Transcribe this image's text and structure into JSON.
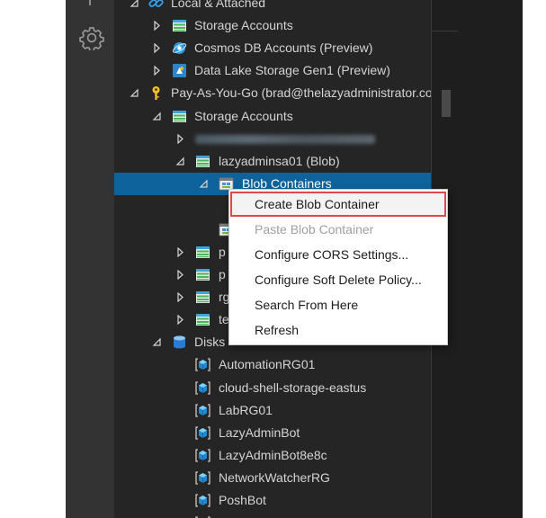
{
  "activity_bar": {
    "settings_icon": "gear-icon"
  },
  "tree": {
    "local_attached": "Local & Attached",
    "local_storage_accounts": "Storage Accounts",
    "cosmos_db": "Cosmos DB Accounts (Preview)",
    "data_lake": "Data Lake Storage Gen1 (Preview)",
    "subscription": "Pay-As-You-Go (brad@thelazyadministrator.com)",
    "storage_accounts": "Storage Accounts",
    "account_lazyadminsa01": "lazyadminsa01 (Blob)",
    "blob_containers": "Blob Containers",
    "partial_p1": "p",
    "partial_p2": "p",
    "partial_rg": "rg",
    "partial_te": "te",
    "disks": "Disks",
    "disk_items": [
      "AutomationRG01",
      "cloud-shell-storage-eastus",
      "LabRG01",
      "LazyAdminBot",
      "LazyAdminBot8e8c",
      "NetworkWatcherRG",
      "PoshBot"
    ]
  },
  "context_menu": {
    "items": [
      {
        "label": "Create Blob Container",
        "state": "highlighted"
      },
      {
        "label": "Paste Blob Container",
        "state": "disabled"
      },
      {
        "label": "Configure CORS Settings...",
        "state": "enabled"
      },
      {
        "label": "Configure Soft Delete Policy...",
        "state": "enabled"
      },
      {
        "label": "Search From Here",
        "state": "enabled"
      },
      {
        "label": "Refresh",
        "state": "enabled"
      }
    ]
  },
  "colors": {
    "selection": "#0e639c",
    "highlight_border": "#e0484e",
    "panel_bg": "#252526",
    "activity_bg": "#333333"
  }
}
